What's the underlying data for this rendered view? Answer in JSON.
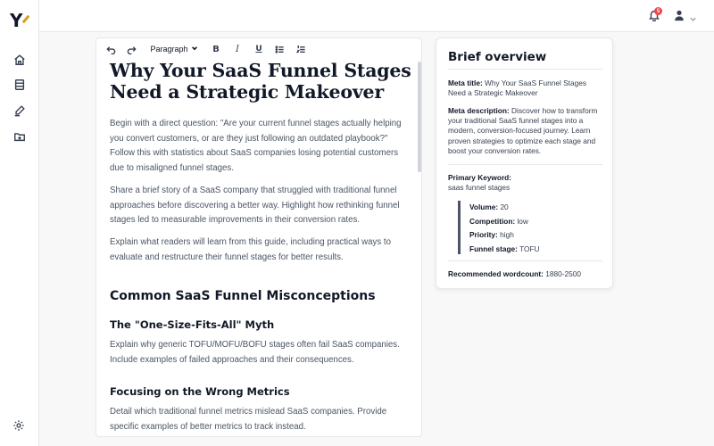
{
  "app": {
    "logo_letter": "Y"
  },
  "topbar": {
    "notification_count": "5"
  },
  "toolbar": {
    "block_type": "Paragraph",
    "bold": "B",
    "italic": "I",
    "underline": "U"
  },
  "document": {
    "title": "Why Your SaaS Funnel Stages Need a Strategic Makeover",
    "paragraphs": [
      "Begin with a direct question: \"Are your current funnel stages actually helping you convert customers, or are they just following an outdated playbook?\" Follow this with statistics about SaaS companies losing potential customers due to misaligned funnel stages.",
      "Share a brief story of a SaaS company that struggled with traditional funnel approaches before discovering a better way. Highlight how rethinking funnel stages led to measurable improvements in their conversion rates.",
      "Explain what readers will learn from this guide, including practical ways to evaluate and restructure their funnel stages for better results."
    ],
    "section_heading": "Common SaaS Funnel Misconceptions",
    "sub1_heading": "The \"One-Size-Fits-All\" Myth",
    "sub1_text": "Explain why generic TOFU/MOFU/BOFU stages often fail SaaS companies. Include examples of failed approaches and their consequences.",
    "sub2_heading": "Focusing on the Wrong Metrics",
    "sub2_text": "Detail which traditional funnel metrics mislead SaaS companies. Provide specific examples of better metrics to track instead."
  },
  "brief": {
    "title": "Brief overview",
    "meta_title_label": "Meta title:",
    "meta_title_value": "Why Your SaaS Funnel Stages Need a Strategic Makeover",
    "meta_desc_label": "Meta description:",
    "meta_desc_value": "Discover how to transform your traditional SaaS funnel stages into a modern, conversion-focused journey. Learn proven strategies to optimize each stage and boost your conversion rates.",
    "primary_keyword_label": "Primary Keyword:",
    "primary_keyword_value": "saas funnel stages",
    "volume_label": "Volume:",
    "volume_value": "20",
    "competition_label": "Competition:",
    "competition_value": "low",
    "priority_label": "Priority:",
    "priority_value": "high",
    "funnel_stage_label": "Funnel stage:",
    "funnel_stage_value": "TOFU",
    "wordcount_label": "Recommended wordcount:",
    "wordcount_value": "1880-2500"
  },
  "icons": {
    "sidebar": [
      "home-icon",
      "book-icon",
      "pen-icon",
      "folder-plus-icon",
      "settings-icon"
    ],
    "toolbar": [
      "undo-icon",
      "redo-icon",
      "bullet-list-icon",
      "numbered-list-icon"
    ],
    "topbar": [
      "bell-icon",
      "user-icon",
      "chevron-down-icon"
    ]
  },
  "colors": {
    "accent": "#d4a017",
    "badge": "#ef4444",
    "keyword_bar": "#4b5563"
  }
}
